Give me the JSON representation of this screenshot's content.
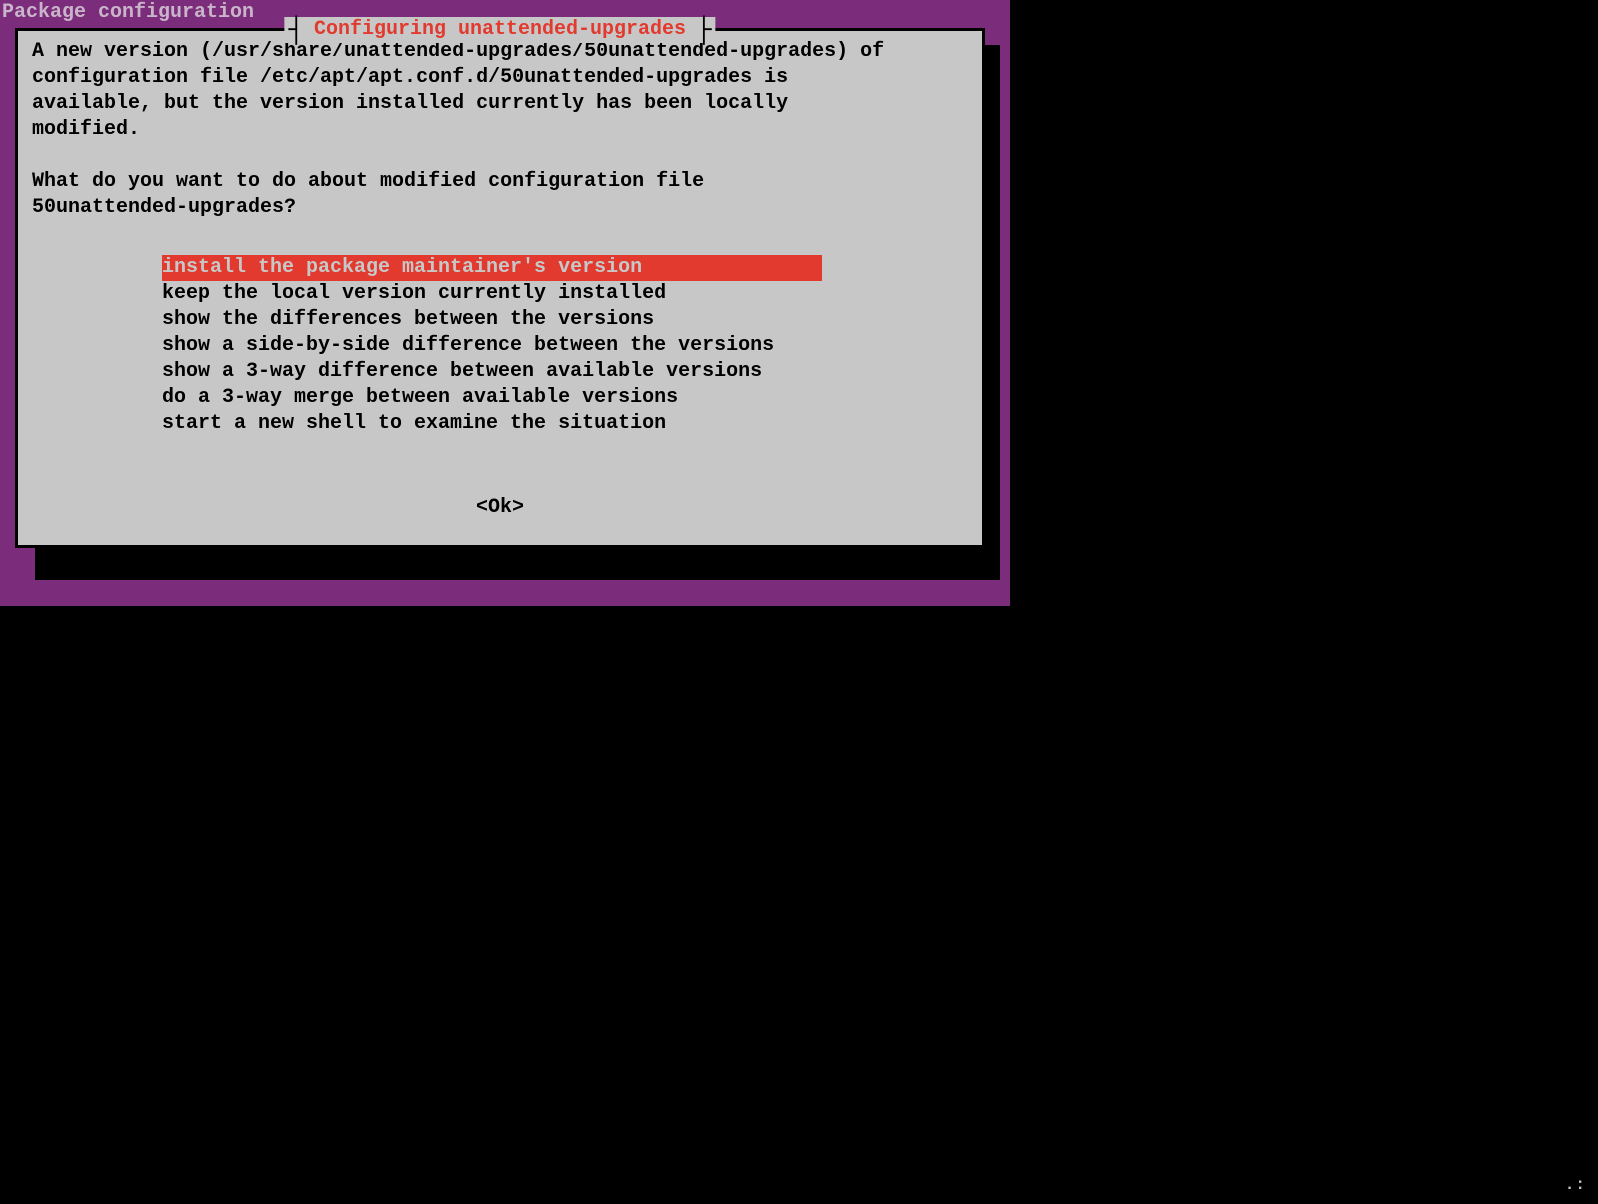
{
  "header": {
    "title": "Package configuration"
  },
  "dialog": {
    "title": "Configuring unattended-upgrades",
    "description_line1": "A new version (/usr/share/unattended-upgrades/50unattended-upgrades) of",
    "description_line2": "configuration file /etc/apt/apt.conf.d/50unattended-upgrades is",
    "description_line3": "available, but the version installed currently has been locally",
    "description_line4": "modified.",
    "prompt_line1": "What do you want to do about modified configuration file",
    "prompt_line2": "50unattended-upgrades?",
    "options": [
      "install the package maintainer's version",
      "keep the local version currently installed",
      "show the differences between the versions",
      "show a side-by-side difference between the versions",
      "show a 3-way difference between available versions",
      "do a 3-way merge between available versions",
      "start a new shell to examine the situation"
    ],
    "selected_index": 0,
    "ok_button": "<Ok>"
  },
  "corner": ".:"
}
